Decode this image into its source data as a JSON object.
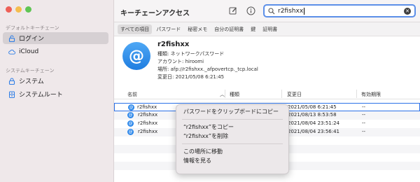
{
  "window": {
    "app_title": "キーチェーンアクセス"
  },
  "colors": {
    "accent": "#2c72e8",
    "sidebar_bg": "#efe8ea"
  },
  "sidebar": {
    "section_default": "デフォルトキーチェーン",
    "section_system": "システムキーチェーン",
    "items": [
      {
        "label": "ログイン",
        "icon": "lock-open-icon",
        "selected": true
      },
      {
        "label": "iCloud",
        "icon": "cloud-icon",
        "selected": false
      },
      {
        "label": "システム",
        "icon": "lock-icon",
        "selected": false
      },
      {
        "label": "システムルート",
        "icon": "cabinet-icon",
        "selected": false
      }
    ]
  },
  "toolbar": {
    "edit_icon": "compose-icon",
    "info_icon": "info-icon"
  },
  "search": {
    "value": "r2fishxx",
    "placeholder": "検索"
  },
  "filters": [
    "すべての項目",
    "パスワード",
    "秘密メモ",
    "自分の証明書",
    "鍵",
    "証明書"
  ],
  "details": {
    "name": "r2fishxx",
    "kind": "種類: ネットワークパスワード",
    "account": "アカウント: hiroomi",
    "location": "場所: afp://r2fishxx._afpovertcp._tcp.local",
    "modified": "変更日: 2021/05/08 6:21:45"
  },
  "table": {
    "headers": {
      "name": "名前",
      "kind": "種類",
      "modified": "変更日",
      "expires": "有効期限"
    },
    "rows": [
      {
        "name": "r2fishxx",
        "kind": "",
        "modified": "2021/05/08 6:21:45",
        "expires": "--"
      },
      {
        "name": "r2fishxx",
        "kind": "",
        "modified": "2021/08/13 8:53:58",
        "expires": "--"
      },
      {
        "name": "r2fishxx",
        "kind": "",
        "modified": "2021/08/04 23:51:24",
        "expires": "--"
      },
      {
        "name": "r2fishxx",
        "kind": "",
        "modified": "2021/08/04 23:56:41",
        "expires": "--"
      }
    ]
  },
  "context_menu": {
    "copy_password": "パスワードをクリップボードにコピー",
    "copy_item": "“r2fishxx”をコピー",
    "delete_item": "“r2fishxx”を削除",
    "move_location": "この場所に移動",
    "show_info": "情報を見る"
  }
}
